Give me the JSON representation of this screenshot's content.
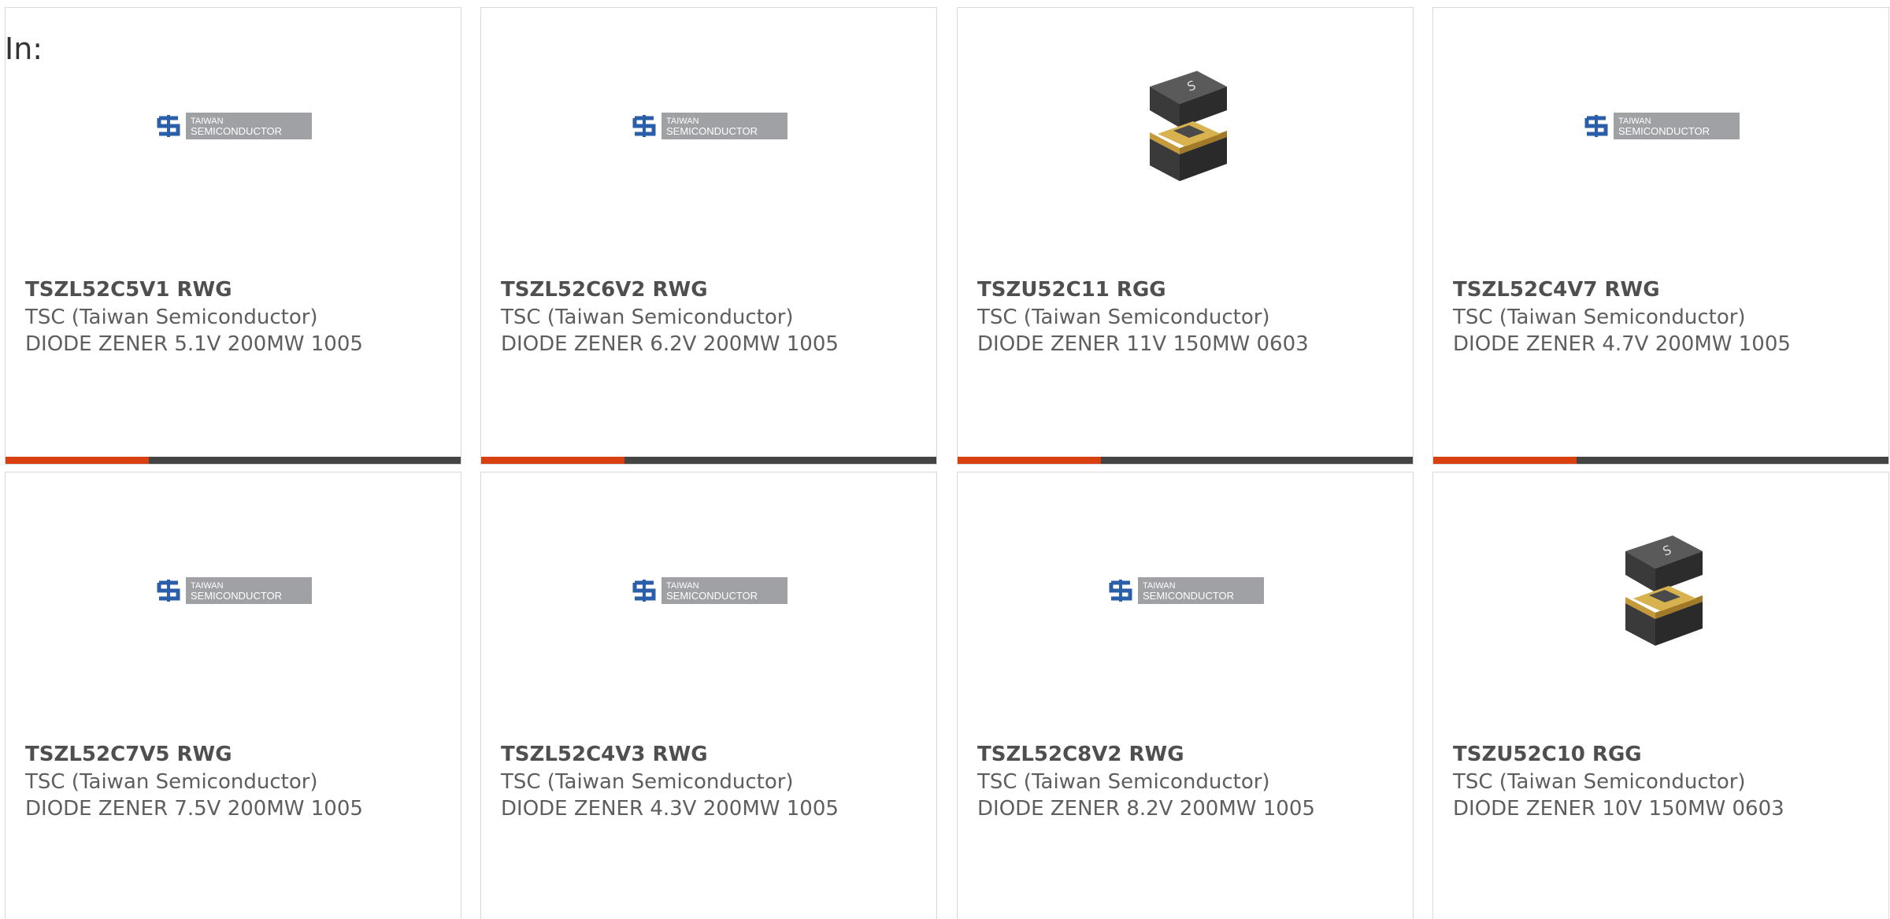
{
  "page": {
    "prefix_label": "In:"
  },
  "colors": {
    "bar_accent": "#d9400f",
    "bar_dark": "#444444",
    "logo_blue": "#2a5ea8",
    "logo_gray": "#9fa1a4"
  },
  "logo": {
    "line1": "TAIWAN",
    "line2": "SEMICONDUCTOR"
  },
  "products": [
    {
      "part": "TSZL52C5V1 RWG",
      "mfr": "TSC (Taiwan Semiconductor)",
      "desc": "DIODE ZENER 5.1V 200MW 1005",
      "image": "tsc-logo"
    },
    {
      "part": "TSZL52C6V2 RWG",
      "mfr": "TSC (Taiwan Semiconductor)",
      "desc": "DIODE ZENER 6.2V 200MW 1005",
      "image": "tsc-logo"
    },
    {
      "part": "TSZU52C11 RGG",
      "mfr": "TSC (Taiwan Semiconductor)",
      "desc": "DIODE ZENER 11V 150MW 0603",
      "image": "chip-package"
    },
    {
      "part": "TSZL52C4V7 RWG",
      "mfr": "TSC (Taiwan Semiconductor)",
      "desc": "DIODE ZENER 4.7V 200MW 1005",
      "image": "tsc-logo"
    },
    {
      "part": "TSZL52C7V5 RWG",
      "mfr": "TSC (Taiwan Semiconductor)",
      "desc": "DIODE ZENER 7.5V 200MW 1005",
      "image": "tsc-logo"
    },
    {
      "part": "TSZL52C4V3 RWG",
      "mfr": "TSC (Taiwan Semiconductor)",
      "desc": "DIODE ZENER 4.3V 200MW 1005",
      "image": "tsc-logo"
    },
    {
      "part": "TSZL52C8V2 RWG",
      "mfr": "TSC (Taiwan Semiconductor)",
      "desc": "DIODE ZENER 8.2V 200MW 1005",
      "image": "tsc-logo"
    },
    {
      "part": "TSZU52C10 RGG",
      "mfr": "TSC (Taiwan Semiconductor)",
      "desc": "DIODE ZENER 10V 150MW 0603",
      "image": "chip-package"
    }
  ]
}
